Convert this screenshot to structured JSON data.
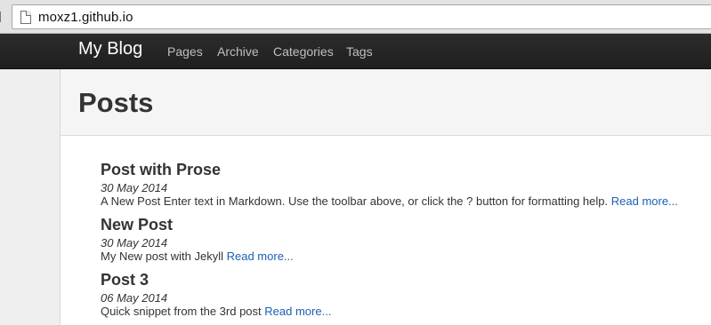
{
  "browser": {
    "url": "moxz1.github.io"
  },
  "navbar": {
    "brand": "My Blog",
    "links": [
      "Pages",
      "Archive",
      "Categories",
      "Tags"
    ]
  },
  "header": {
    "title": "Posts"
  },
  "posts": [
    {
      "title": "Post with Prose",
      "date": "30 May 2014",
      "excerpt": "A New Post Enter text in Markdown. Use the toolbar above, or click the ? button for formatting help.",
      "read_more": "Read more..."
    },
    {
      "title": "New Post",
      "date": "30 May 2014",
      "excerpt": "My New post with Jekyll",
      "read_more": "Read more..."
    },
    {
      "title": "Post 3",
      "date": "06 May 2014",
      "excerpt": "Quick snippet from the 3rd post",
      "read_more": "Read more..."
    }
  ],
  "colors": {
    "navbar_bg": "#222222",
    "link": "#1a5fb4",
    "text": "#333333"
  }
}
